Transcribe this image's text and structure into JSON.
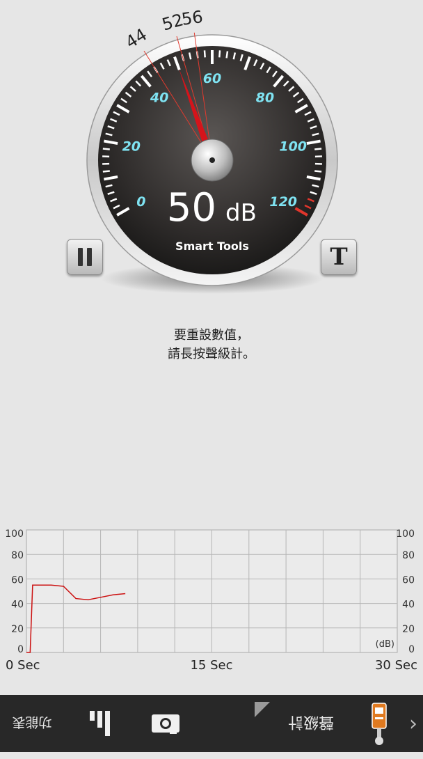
{
  "gauge": {
    "reading_value": "50",
    "reading_unit": "dB",
    "brand": "Smart Tools",
    "scale_labels": [
      "0",
      "20",
      "40",
      "60",
      "80",
      "100",
      "120"
    ],
    "needle_db": 50,
    "marker_labels": [
      "44",
      "52",
      "56"
    ],
    "marker_values": [
      44,
      52,
      56
    ],
    "scale_min": 0,
    "scale_max": 120,
    "danger_from_db": 115
  },
  "buttons": {
    "pause_icon": "pause-icon",
    "text_button_label": "T"
  },
  "hint": {
    "line1": "要重設數值，",
    "line2": "請長按聲級計。"
  },
  "chart_data": {
    "type": "line",
    "x": [
      0,
      0.3,
      0.5,
      1,
      2,
      3,
      4,
      5,
      6,
      7,
      8
    ],
    "series": [
      {
        "values": [
          0,
          0,
          55,
          55,
          55,
          54,
          44,
          43,
          45,
          47,
          48
        ]
      }
    ],
    "xlim": [
      0,
      30
    ],
    "ylim": [
      0,
      100
    ],
    "yticks": [
      "0",
      "20",
      "40",
      "60",
      "80",
      "100"
    ],
    "xlabels": [
      "0 Sec",
      "15 Sec",
      "30 Sec"
    ],
    "unit_label": "(dB)",
    "grid": true,
    "line_color": "#cc1111"
  },
  "bottom_bar": {
    "function_label": "功能表",
    "meter_label": "聲級計",
    "chevron": "›",
    "icons": [
      "bars-icon",
      "camera-icon",
      "sound-meter-icon"
    ]
  }
}
